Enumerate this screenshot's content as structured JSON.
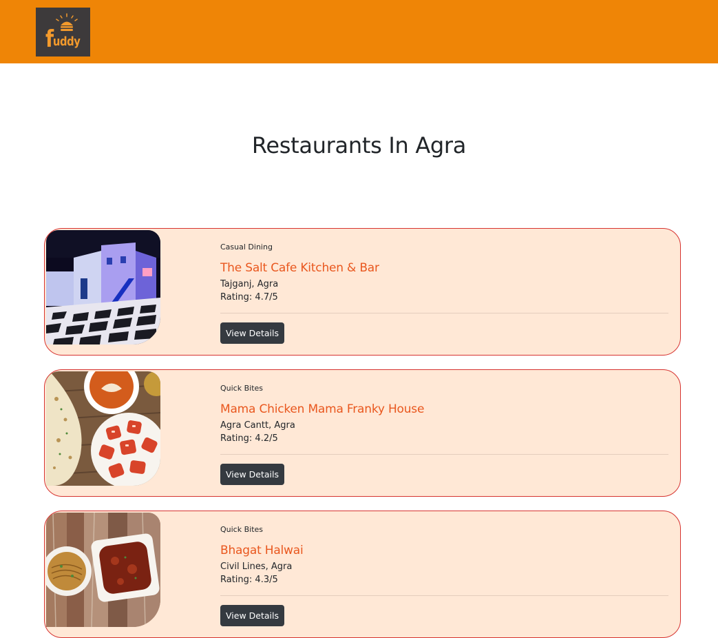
{
  "navbar": {
    "logo_text": "uddy",
    "logo_f": "f",
    "colors": {
      "background": "#ef8506",
      "logo_bg": "#3d3a3b",
      "logo_fg": "#f39a2c"
    }
  },
  "page": {
    "title": "Restaurants In Agra"
  },
  "restaurants": [
    {
      "cuisine": "Casual Dining",
      "name": "The Salt Cafe Kitchen & Bar",
      "location": "Tajganj, Agra",
      "rating": "Rating: 4.7/5",
      "button_label": "View Details",
      "image": "restaurant-exterior-photo"
    },
    {
      "cuisine": "Quick Bites",
      "name": "Mama Chicken Mama Franky House",
      "location": "Agra Cantt, Agra",
      "rating": "Rating: 4.2/5",
      "button_label": "View Details",
      "image": "tandoori-naan-food-photo"
    },
    {
      "cuisine": "Quick Bites",
      "name": "Bhagat Halwai",
      "location": "Civil Lines, Agra",
      "rating": "Rating: 4.3/5",
      "button_label": "View Details",
      "image": "noodles-curry-food-photo"
    }
  ],
  "colors": {
    "card_bg": "#ffe8d6",
    "card_border": "#d6322f",
    "name_text": "#e9571e",
    "button_bg": "#353a40"
  }
}
